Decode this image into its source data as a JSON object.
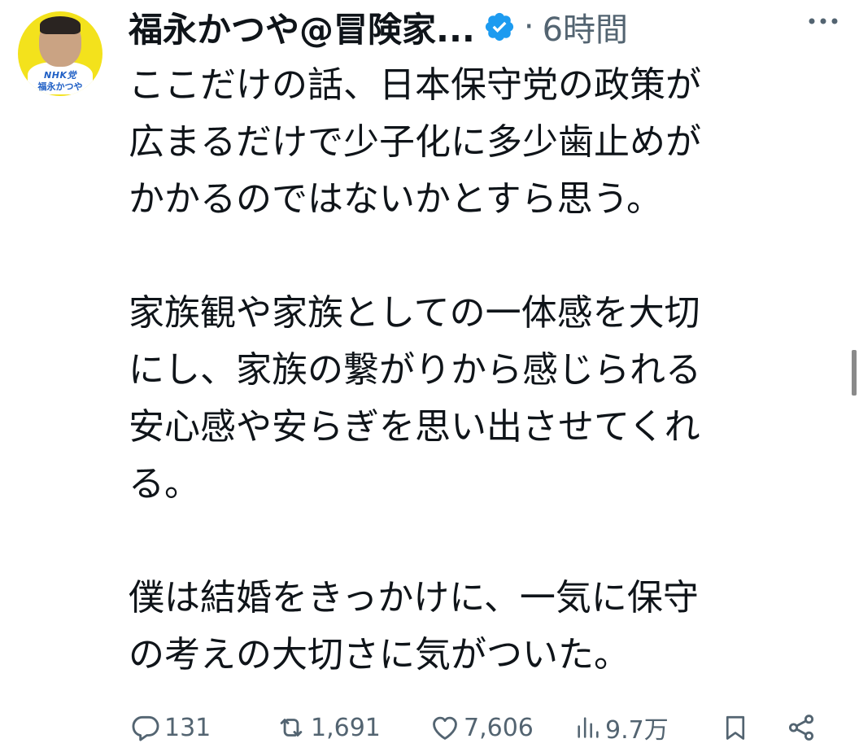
{
  "author": {
    "display_name": "福永かつや@冒険家...",
    "avatar_badge_line1": "NHK党",
    "avatar_badge_line2": "福永かつや",
    "verified": true
  },
  "meta": {
    "separator": "·",
    "time_ago": "6時間"
  },
  "tweet": {
    "paragraphs": [
      "ここだけの話、日本保守党の政策が\n広まるだけで少子化に多少歯止めが\nかかるのではないかとすら思う。",
      "家族観や家族としての一体感を大切\nにし、家族の繋がりから感じられる\n安心感や安らぎを思い出させてくれ\nる。",
      "僕は結婚をきっかけに、一気に保守\nの考えの大切さに気がついた。"
    ]
  },
  "actions": {
    "reply_count": "131",
    "retweet_count": "1,691",
    "like_count": "7,606",
    "view_count": "9.7万"
  },
  "colors": {
    "text": "#0f1419",
    "secondary": "#536471",
    "verified_badge": "#1d9bf0",
    "avatar_bg": "#f3e21c"
  },
  "icons": {
    "verified": "verified-badge-icon",
    "more": "more-horizontal-icon",
    "reply": "reply-icon",
    "retweet": "retweet-icon",
    "like": "heart-icon",
    "views": "views-icon",
    "bookmark": "bookmark-icon",
    "share": "share-icon"
  }
}
